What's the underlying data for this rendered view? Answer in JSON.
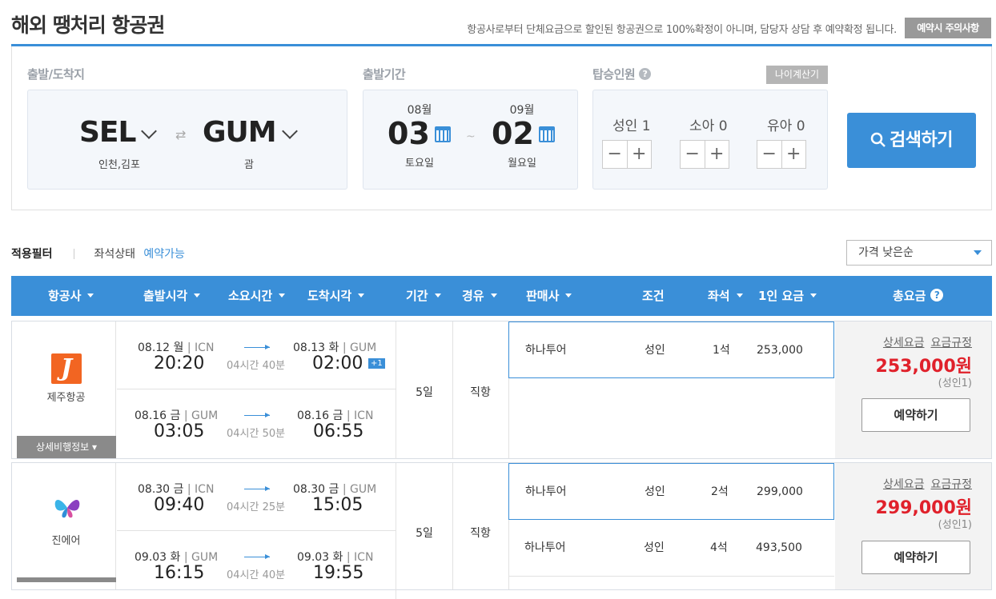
{
  "header": {
    "title": "해외 땡처리 항공권",
    "notice": "항공사로부터 단체요금으로 할인된 항공권으로 100%확정이 아니며, 담당자 상담 후 예약확정 됩니다.",
    "caution_label": "예약시 주의사항"
  },
  "search": {
    "route_label": "출발/도착지",
    "origin_code": "SEL",
    "origin_city": "인천,김포",
    "dest_code": "GUM",
    "dest_city": "괌",
    "swap_icon": "swap-arrows-icon",
    "period_label": "출발기간",
    "depart_month": "08월",
    "depart_day": "03",
    "depart_weekday": "토요일",
    "return_month": "09월",
    "return_day": "02",
    "return_weekday": "월요일",
    "tilde": "~",
    "pax_label": "탑승인원",
    "age_calc_label": "나이계산기",
    "adult_label": "성인",
    "adult_count": "1",
    "child_label": "소아",
    "child_count": "0",
    "infant_label": "유아",
    "infant_count": "0",
    "minus": "−",
    "plus": "+",
    "search_label": "검색하기"
  },
  "filter": {
    "applied_label": "적용필터",
    "seat_status_label": "좌석상태",
    "seat_status_value": "예약가능",
    "sort_value": "가격 낮은순"
  },
  "table_headers": {
    "airline": "항공사",
    "depart_time": "출발시각",
    "duration": "소요시간",
    "arrive_time": "도착시각",
    "period": "기간",
    "stops": "경유",
    "seller": "판매사",
    "condition": "조건",
    "seats": "좌석",
    "unit_price": "1인 요금",
    "total": "총요금"
  },
  "results": [
    {
      "airline": "제주항공",
      "detail_label": "상세비행정보",
      "out": {
        "dep_date": "08.12 월",
        "dep_ap": "ICN",
        "dep_time": "20:20",
        "dur": "04시간 40분",
        "arr_date": "08.13 화",
        "arr_ap": "GUM",
        "arr_time": "02:00",
        "plus_day": "+1"
      },
      "ret": {
        "dep_date": "08.16 금",
        "dep_ap": "GUM",
        "dep_time": "03:05",
        "dur": "04시간 50분",
        "arr_date": "08.16 금",
        "arr_ap": "ICN",
        "arr_time": "06:55"
      },
      "period": "5일",
      "stops": "직항",
      "sellers": [
        {
          "name": "하나투어",
          "cond": "성인",
          "seats": "1석",
          "price": "253,000"
        }
      ],
      "links": [
        "상세요금",
        "요금규정"
      ],
      "total": "253,000원",
      "per": "(성인1)",
      "book_label": "예약하기"
    },
    {
      "airline": "진에어",
      "detail_label": "",
      "out": {
        "dep_date": "08.30 금",
        "dep_ap": "ICN",
        "dep_time": "09:40",
        "dur": "04시간 25분",
        "arr_date": "08.30 금",
        "arr_ap": "GUM",
        "arr_time": "15:05"
      },
      "ret": {
        "dep_date": "09.03 화",
        "dep_ap": "GUM",
        "dep_time": "16:15",
        "dur": "04시간 40분",
        "arr_date": "09.03 화",
        "arr_ap": "ICN",
        "arr_time": "19:55"
      },
      "period": "5일",
      "stops": "직항",
      "sellers": [
        {
          "name": "하나투어",
          "cond": "성인",
          "seats": "2석",
          "price": "299,000"
        },
        {
          "name": "하나투어",
          "cond": "성인",
          "seats": "4석",
          "price": "493,500"
        }
      ],
      "links": [
        "상세요금",
        "요금규정"
      ],
      "total": "299,000원",
      "per": "(성인1)",
      "book_label": "예약하기"
    }
  ],
  "colors": {
    "accent": "#3a8fd8",
    "price": "#e0212b",
    "jeju": "#f26522"
  }
}
